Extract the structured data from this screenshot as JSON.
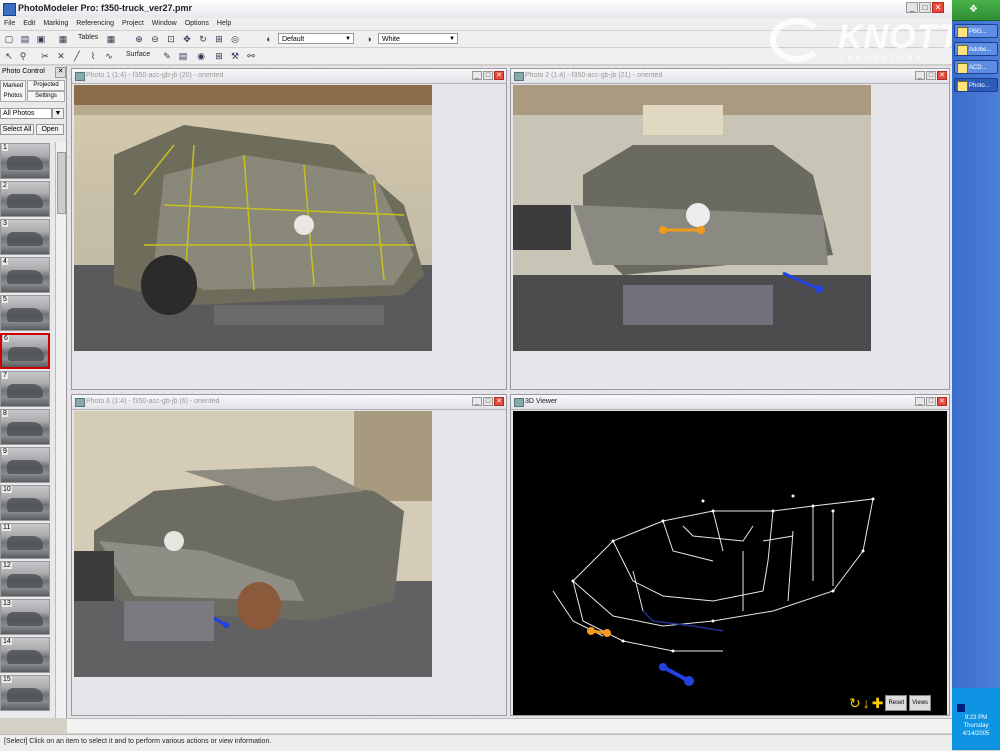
{
  "window": {
    "title": "PhotoModeler Pro: f350-truck_ver27.pmr"
  },
  "menu": [
    "File",
    "Edit",
    "Marking",
    "Referencing",
    "Project",
    "Window",
    "Options",
    "Help"
  ],
  "toolbar": {
    "tables_label": "Tables",
    "surface_label": "Surface",
    "default_select": "Default",
    "white_select": "White"
  },
  "logo": {
    "name": "KNOTT",
    "subtitle": "LABORATORY"
  },
  "left_panel": {
    "title": "Photo Control",
    "tabs": [
      "Marked Photos",
      "Projected",
      "Settings"
    ],
    "filter": "All Photos",
    "select_all": "Select All",
    "open": "Open",
    "thumbnails": [
      "1",
      "2",
      "3",
      "4",
      "5",
      "6",
      "7",
      "8",
      "9",
      "10",
      "11",
      "12",
      "13",
      "14",
      "15"
    ],
    "selected_index": 5
  },
  "photo_windows": [
    {
      "title": "Photo 1 (1:4) - f350-acc-gb-jb (20) - oriented"
    },
    {
      "title": "Photo 2 (1:4) - f350-acc-gb-jb (21) - oriented"
    },
    {
      "title": "Photo 6 (1:4) - f350-acc-gb-jb (6) - oriented"
    }
  ],
  "viewer": {
    "title": "3D Viewer",
    "reset": "Reset",
    "views": "Views"
  },
  "statusbar": {
    "text": "[Select] Click on an item to select it and to perform various actions or view information."
  },
  "taskbar": {
    "items": [
      "PBG...",
      "Adobe...",
      "ACD...",
      "Photo..."
    ],
    "time": "9:23 PM",
    "day": "Thursday",
    "date": "4/14/2005"
  },
  "colors": {
    "accent_orange": "#f39a1c",
    "accent_blue": "#2340e0",
    "edge_yellow": "#c8c020"
  }
}
